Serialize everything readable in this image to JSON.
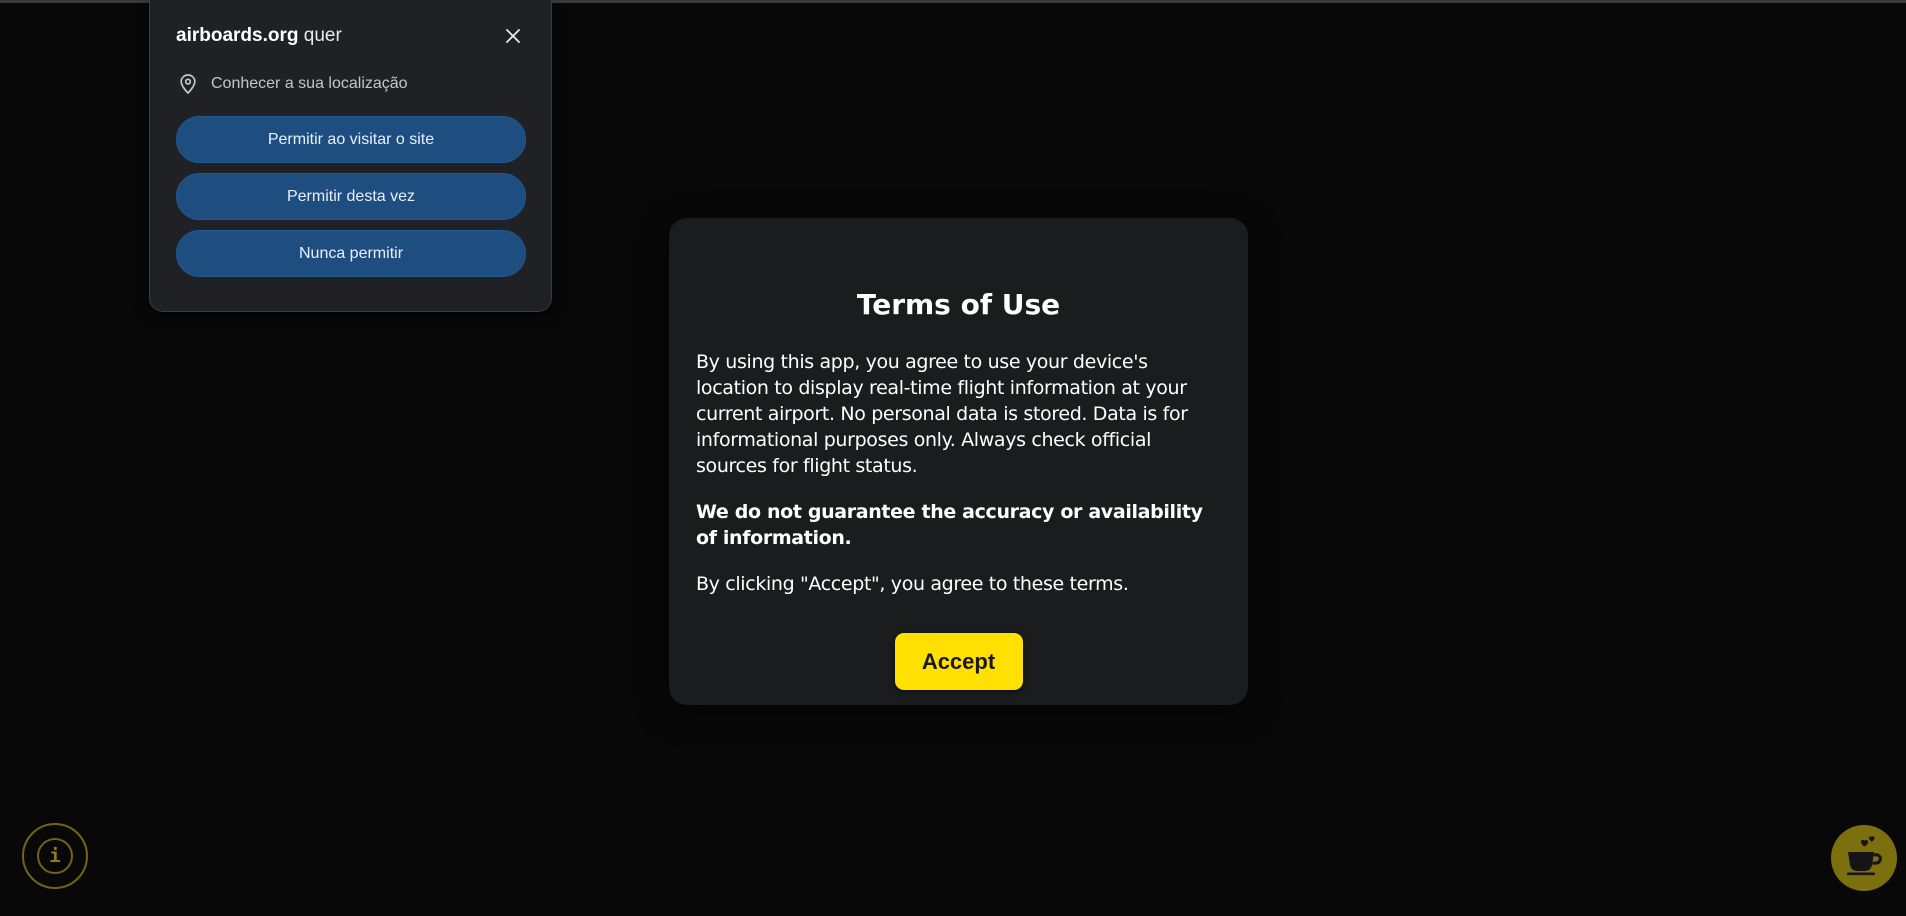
{
  "permission_popup": {
    "site": "airboards.org",
    "suffix": " quer",
    "permission_text": "Conhecer a sua localização",
    "buttons": {
      "allow_visit": "Permitir ao visitar o site",
      "allow_once": "Permitir desta vez",
      "never_allow": "Nunca permitir"
    }
  },
  "terms": {
    "title": "Terms of Use",
    "paragraph1": "By using this app, you agree to use your device's location to display real-time flight information at your current airport. No personal data is stored. Data is for informational purposes only. Always check official sources for flight status.",
    "paragraph2": "We do not guarantee the accuracy or availability of information.",
    "paragraph3": "By clicking \"Accept\", you agree to these terms.",
    "accept_label": "Accept"
  },
  "floating": {
    "info_glyph": "i",
    "info_icon": "info-icon",
    "coffee_icon": "coffee-cup-icon"
  },
  "colors": {
    "background": "#080808",
    "popup_button": "#1d4e7f",
    "accept_button": "#ffe000",
    "coffee_button": "#7c6f0e",
    "info_ring": "#6f6515"
  }
}
